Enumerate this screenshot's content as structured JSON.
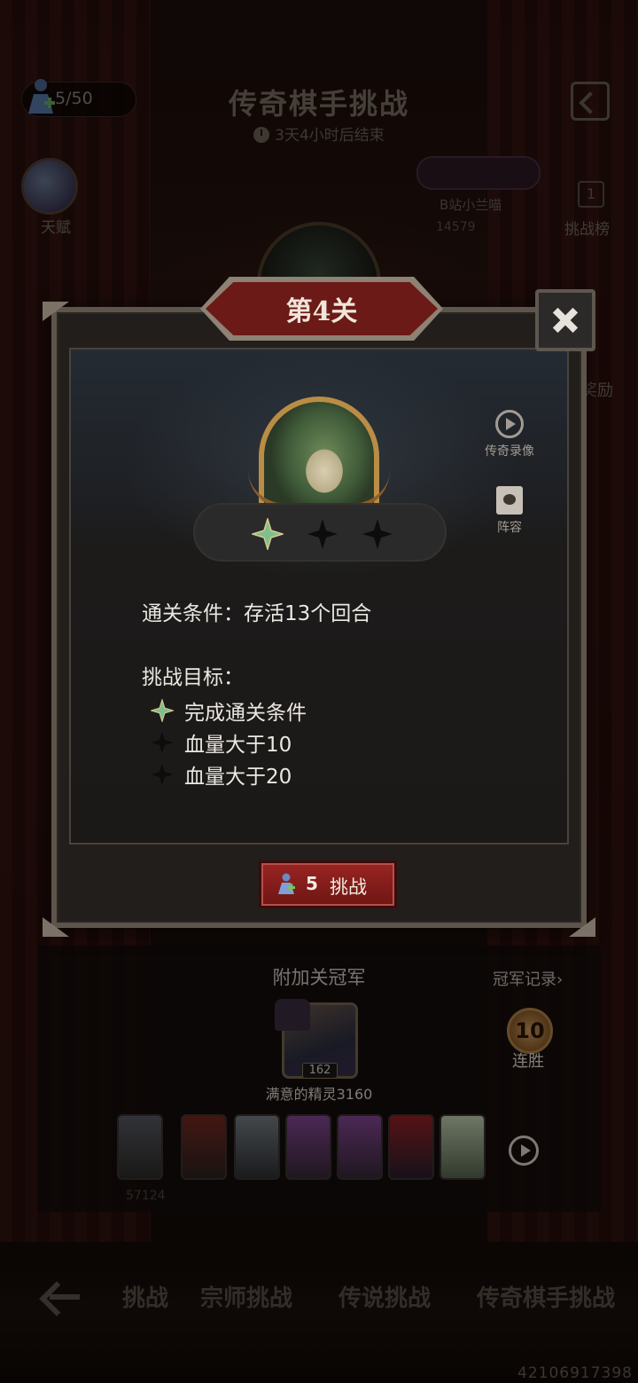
{
  "header": {
    "energy": "5/50",
    "title": "传奇棋手挑战",
    "countdown": "3天4小时后结束",
    "talent_label": "天赋",
    "rank_name": "B站小兰喵",
    "rank_score": "14579",
    "rank_board_icon": "1",
    "rank_board_label": "挑战榜",
    "reward_label": "奖励"
  },
  "modal": {
    "stage_title": "第4关",
    "replay_label": "传奇录像",
    "lineup_label": "阵容",
    "stars_earned": 1,
    "stars_total": 3,
    "clear_condition_label": "通关条件：",
    "clear_condition_value": "存活13个回合",
    "goals_heading": "挑战目标：",
    "goals": [
      {
        "text": "完成通关条件",
        "achieved": true
      },
      {
        "text": "血量大于10",
        "achieved": false
      },
      {
        "text": "血量大于20",
        "achieved": false
      }
    ],
    "challenge_cost": "5",
    "challenge_label": "挑战"
  },
  "champion": {
    "title": "附加关冠军",
    "record_link": "冠军记录›",
    "level": "162",
    "name": "满意的精灵3160",
    "streak_number": "10",
    "streak_label": "连胜",
    "lineup_score": "57124"
  },
  "bottom_nav": {
    "tabs": [
      "挑战",
      "宗师挑战",
      "传说挑战",
      "传奇棋手挑战"
    ],
    "user_id": "42106917398"
  },
  "colors": {
    "accent_red": "#9a2422",
    "gold_frame": "#b98d45",
    "star_green": "#7fbf8f"
  }
}
